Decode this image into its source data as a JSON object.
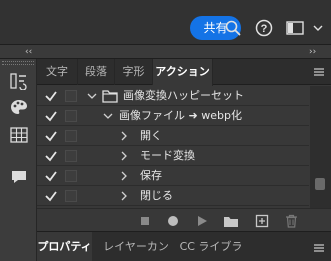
{
  "topbar": {
    "share_label": "共有",
    "icons": [
      "search-icon",
      "help-icon",
      "workspace-icon",
      "chevron-down-icon"
    ]
  },
  "collapse": {
    "left": "‹‹",
    "right": "››"
  },
  "tabs": [
    {
      "label": "文字",
      "active": false
    },
    {
      "label": "段落",
      "active": false
    },
    {
      "label": "字形",
      "active": false
    },
    {
      "label": "アクション",
      "active": true
    }
  ],
  "actions": {
    "rows": [
      {
        "label": "画像変換ハッピーセット",
        "type": "set",
        "expanded": true,
        "checked": true
      },
      {
        "label": "画像ファイル ➜ webp化",
        "type": "action",
        "expanded": true,
        "checked": true
      },
      {
        "label": "開く",
        "type": "step",
        "checked": true
      },
      {
        "label": "モード変換",
        "type": "step",
        "checked": true
      },
      {
        "label": "保存",
        "type": "step",
        "checked": true
      },
      {
        "label": "閉じる",
        "type": "step",
        "checked": true
      }
    ]
  },
  "bottom_tabs": [
    {
      "label": "プロパティ",
      "active": true
    },
    {
      "label": "レイヤーカンプ",
      "active": false
    },
    {
      "label": "CC ライブラリ",
      "active": false
    }
  ],
  "colors": {
    "accent": "#1473e6",
    "panel_bg": "#383838",
    "topbar_bg": "#323232"
  }
}
